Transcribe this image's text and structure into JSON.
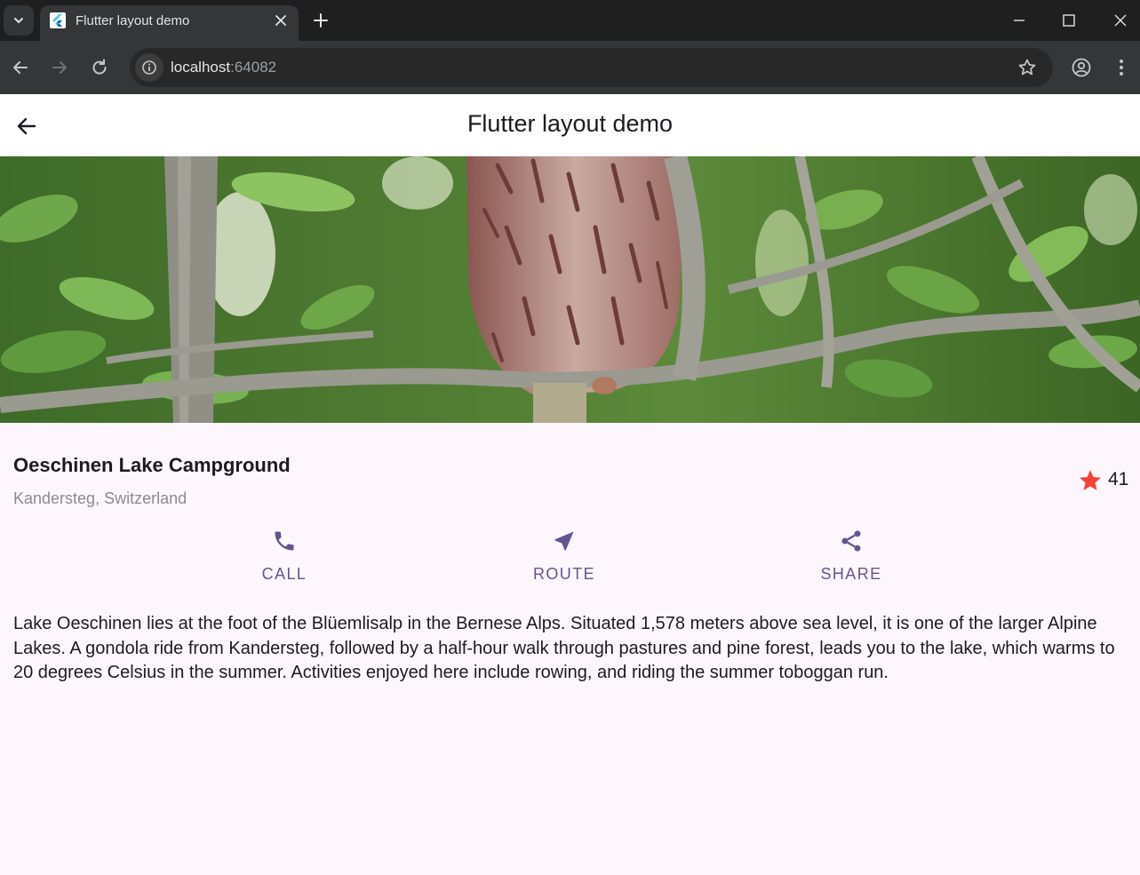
{
  "browser": {
    "tab_title": "Flutter layout demo",
    "url_host": "localhost",
    "url_port": ":64082"
  },
  "app": {
    "title": "Flutter layout demo"
  },
  "place": {
    "name": "Oeschinen Lake Campground",
    "location": "Kandersteg, Switzerland",
    "rating_count": "41"
  },
  "actions": [
    {
      "label": "CALL",
      "icon": "phone-icon"
    },
    {
      "label": "ROUTE",
      "icon": "navigation-icon"
    },
    {
      "label": "SHARE",
      "icon": "share-icon"
    }
  ],
  "description": "Lake Oeschinen lies at the foot of the Blüemlisalp in the Bernese Alps. Situated 1,578 meters above sea level, it is one of the larger Alpine Lakes. A gondola ride from Kandersteg, followed by a half-hour walk through pastures and pine forest, leads you to the lake, which warms to 20 degrees Celsius in the summer. Activities enjoyed here include rowing, and riding the summer toboggan run.",
  "colors": {
    "accent": "#65558f",
    "star": "#f44336",
    "background": "#fdf7fd"
  }
}
